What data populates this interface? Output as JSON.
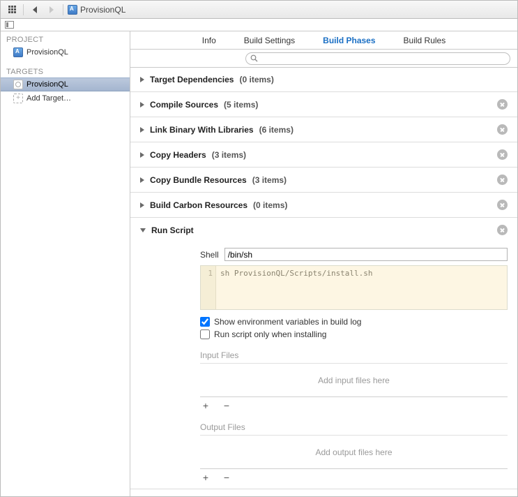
{
  "toolbar": {
    "title": "ProvisionQL"
  },
  "sidebar": {
    "project_label": "PROJECT",
    "project_name": "ProvisionQL",
    "targets_label": "TARGETS",
    "target_name": "ProvisionQL",
    "add_target": "Add Target…"
  },
  "tabs": {
    "info": "Info",
    "build_settings": "Build Settings",
    "build_phases": "Build Phases",
    "build_rules": "Build Rules"
  },
  "search": {
    "placeholder": ""
  },
  "phases": [
    {
      "title": "Target Dependencies",
      "count": "(0 items)",
      "deletable": false
    },
    {
      "title": "Compile Sources",
      "count": "(5 items)",
      "deletable": true
    },
    {
      "title": "Link Binary With Libraries",
      "count": "(6 items)",
      "deletable": true
    },
    {
      "title": "Copy Headers",
      "count": "(3 items)",
      "deletable": true
    },
    {
      "title": "Copy Bundle Resources",
      "count": "(3 items)",
      "deletable": true
    },
    {
      "title": "Build Carbon Resources",
      "count": "(0 items)",
      "deletable": true
    }
  ],
  "run_script": {
    "title": "Run Script",
    "shell_label": "Shell",
    "shell_value": "/bin/sh",
    "line_no": "1",
    "code": "sh ProvisionQL/Scripts/install.sh",
    "show_env": "Show environment variables in build log",
    "run_only": "Run script only when installing",
    "input_files": "Input Files",
    "add_input": "Add input files here",
    "output_files": "Output Files",
    "add_output": "Add output files here",
    "plus": "+",
    "minus": "−"
  }
}
